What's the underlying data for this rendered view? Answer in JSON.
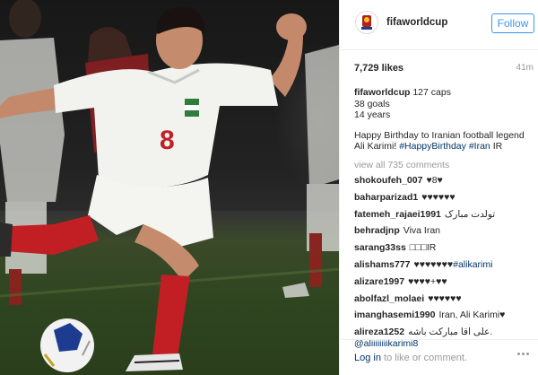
{
  "post": {
    "username": "fifaworldcup",
    "follow_label": "Follow",
    "likes": "7,729 likes",
    "time_ago": "41m",
    "caption": {
      "username": "fifaworldcup",
      "line1": "127 caps",
      "line2": "38 goals",
      "line3": "14 years",
      "message": "Happy Birthday to Iranian football legend Ali Karimi!",
      "hashtag1": "#HappyBirthday",
      "hashtag2": "#Iran",
      "flag": "IR"
    },
    "view_all": "view all 735 comments",
    "comments": [
      {
        "user": "shokoufeh_007",
        "text": "♥8♥"
      },
      {
        "user": "baharparizad1",
        "text": "♥♥♥♥♥♥"
      },
      {
        "user": "fatemeh_rajaei1991",
        "text": "تولدت مبارک"
      },
      {
        "user": "behradjnp",
        "text": "Viva Iran"
      },
      {
        "user": "sarang33ss",
        "text": "□□□IR"
      },
      {
        "user": "alishams777",
        "text": "♥♥♥♥♥♥♥",
        "tag": "#alikarimi"
      },
      {
        "user": "alizare1997",
        "text": "♥♥♥♥+♥♥"
      },
      {
        "user": "abolfazl_molaei",
        "text": "♥♥♥♥♥♥"
      },
      {
        "user": "imanghasemi1990",
        "text": "Iran, Ali Karimi♥"
      },
      {
        "user": "alireza1252",
        "text": "علی آقا مبارکت باشه.",
        "tag": "@aliiiiiiiikarimi8"
      }
    ],
    "footer": {
      "login": "Log in",
      "rest": " to like or comment."
    }
  },
  "colors": {
    "link": "#003569",
    "follow": "#3897f0",
    "muted": "#999999",
    "kit": "#f2f2ee",
    "socks": "#c21f24"
  },
  "icons": [
    "fifa-logo-icon",
    "more-options-icon"
  ]
}
